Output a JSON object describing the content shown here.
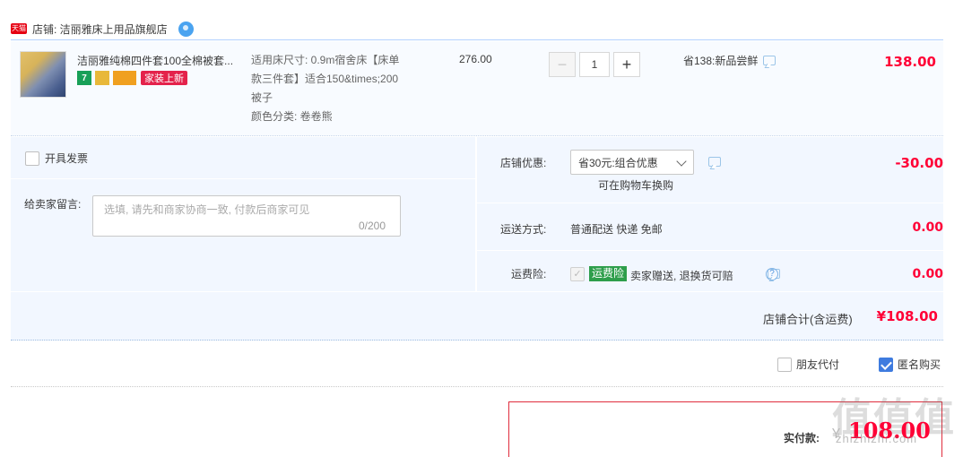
{
  "shop": {
    "badge_text": "天猫",
    "label": "店铺: 洁丽雅床上用品旗舰店"
  },
  "item": {
    "title": "洁丽雅纯棉四件套100全棉被套...",
    "service_7": "7",
    "service_new": "家装上新",
    "props": [
      "适用床尺寸: 0.9m宿舍床【床单",
      "款三件套】适合150&times;200",
      "被子",
      "颜色分类: 卷卷熊"
    ],
    "unit_price": "276.00",
    "quantity_minus": "−",
    "quantity": "1",
    "quantity_plus": "+",
    "promo": "省138:新品尝鲜",
    "total": "138.00"
  },
  "options": {
    "invoice_label": "开具发票",
    "memo_label": "给卖家留言:",
    "memo_placeholder": "选填, 请先和商家协商一致, 付款后商家可见",
    "memo_count": "0/200",
    "shop_discount_label": "店铺优惠:",
    "shop_discount_selected": "省30元:组合优惠",
    "coupon_link": "可在购物车换购",
    "shop_discount_value": "-30.00",
    "shipping_label": "运送方式:",
    "shipping_value": "普通配送 快递 免邮",
    "shipping_fee": "0.00",
    "insurance_label": "运费险:",
    "insurance_check": "✓",
    "insurance_badge": "运费险",
    "insurance_text": "卖家赠送, 退换货可赔",
    "insurance_help": "?",
    "insurance_fee": "0.00"
  },
  "subtotal": {
    "label": "店铺合计(含运费)",
    "value": "¥108.00"
  },
  "bottom": {
    "friend_pay_label": "朋友代付",
    "anonymous_label": "匿名购买",
    "anonymous_checked": true
  },
  "payment": {
    "label": "实付款:",
    "currency": "¥",
    "value": "108.00"
  },
  "watermark": {
    "mark": "值值值",
    "text": "zhizhizhi.com"
  },
  "colors": {
    "price_red": "#ff0036",
    "panel_blue": "#f2f7ff",
    "accent_blue": "#3e7bdf",
    "insurance_green": "#2e9e4b"
  }
}
